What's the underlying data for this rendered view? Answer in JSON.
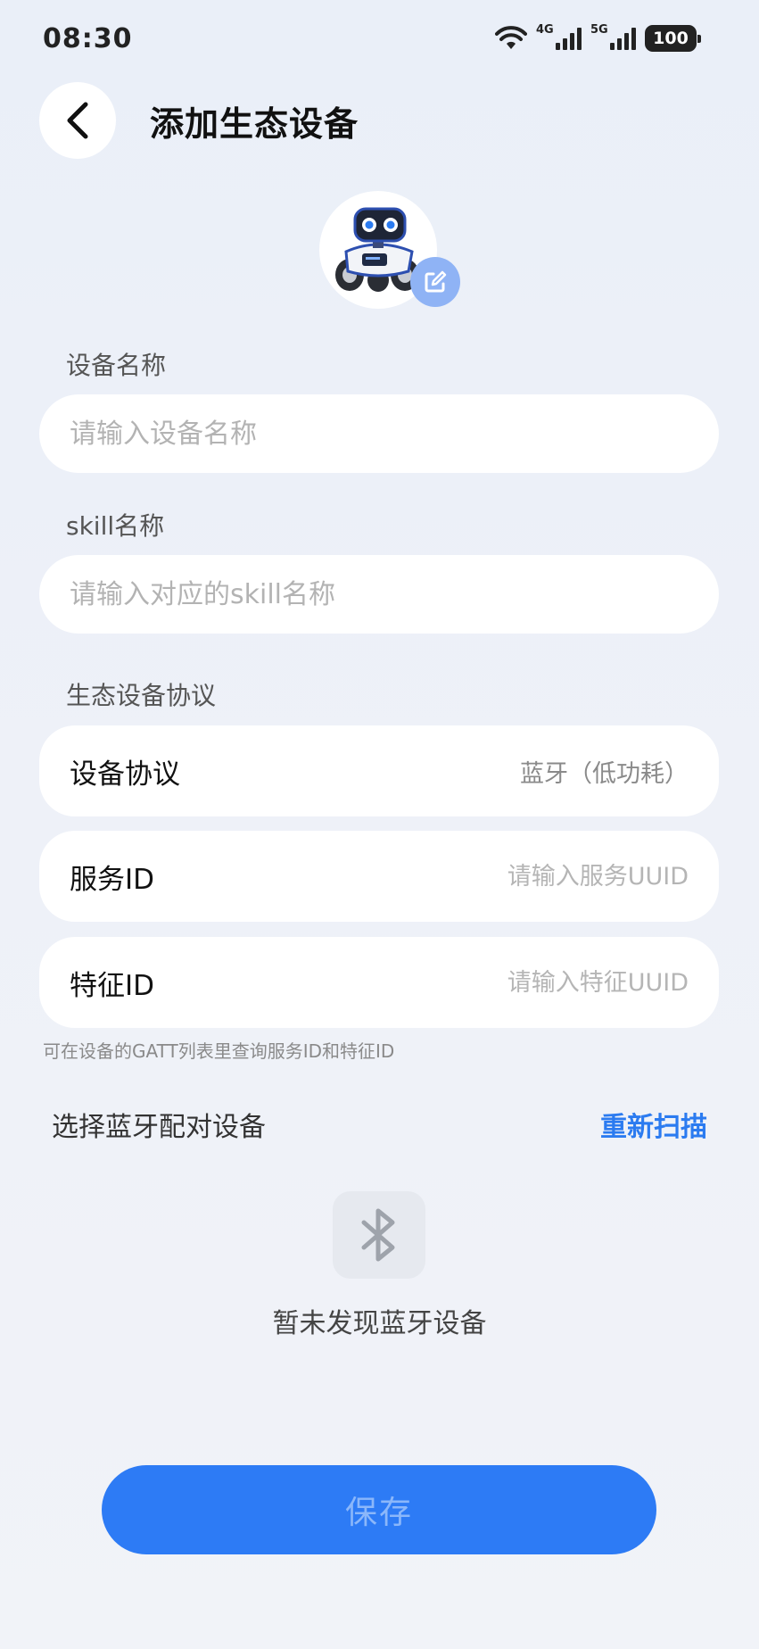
{
  "status_bar": {
    "time": "08:30",
    "signal1_label": "4G",
    "signal2_label": "5G",
    "battery": "100"
  },
  "header": {
    "title": "添加生态设备",
    "back_icon": "chevron-left-icon"
  },
  "avatar": {
    "image": "robot-icon",
    "edit_icon": "edit-icon"
  },
  "form": {
    "device_name_label": "设备名称",
    "device_name_placeholder": "请输入设备名称",
    "device_name_value": "",
    "skill_name_label": "skill名称",
    "skill_name_placeholder": "请输入对应的skill名称",
    "skill_name_value": "",
    "protocol_section_label": "生态设备协议",
    "protocol_label": "设备协议",
    "protocol_value": "蓝牙（低功耗）",
    "service_id_label": "服务ID",
    "service_id_placeholder": "请输入服务UUID",
    "characteristic_id_label": "特征ID",
    "characteristic_id_placeholder": "请输入特征UUID",
    "hint": "可在设备的GATT列表里查询服务ID和特征ID"
  },
  "bluetooth": {
    "select_label": "选择蓝牙配对设备",
    "rescan_label": "重新扫描",
    "empty_icon": "bluetooth-icon",
    "empty_text": "暂未发现蓝牙设备"
  },
  "footer": {
    "save_label": "保存"
  },
  "colors": {
    "accent": "#2b7bf0",
    "save_button": "#2d7bf5",
    "background": "#eef1f8"
  }
}
